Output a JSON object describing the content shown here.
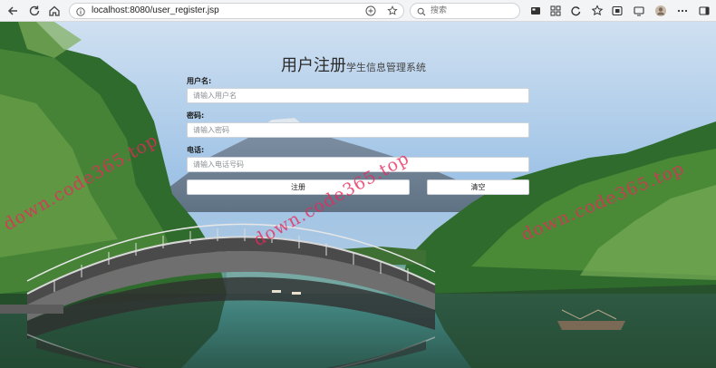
{
  "browser": {
    "url": "localhost:8080/user_register.jsp",
    "search_placeholder": "搜索"
  },
  "page": {
    "title_main": "用户注册",
    "title_sub": "学生信息管理系统",
    "fields": [
      {
        "label": "用户名:",
        "placeholder": "请输入用户名"
      },
      {
        "label": "密码:",
        "placeholder": "请输入密码"
      },
      {
        "label": "电话:",
        "placeholder": "请输入电话号码"
      }
    ],
    "register_label": "注册",
    "clear_label": "清空"
  },
  "watermark": "down.code365.top",
  "colors": {
    "watermark": "#e8285a",
    "sky": "#9fc3e6",
    "water": "#3f7f7a",
    "forest": "#2f6b2c"
  }
}
